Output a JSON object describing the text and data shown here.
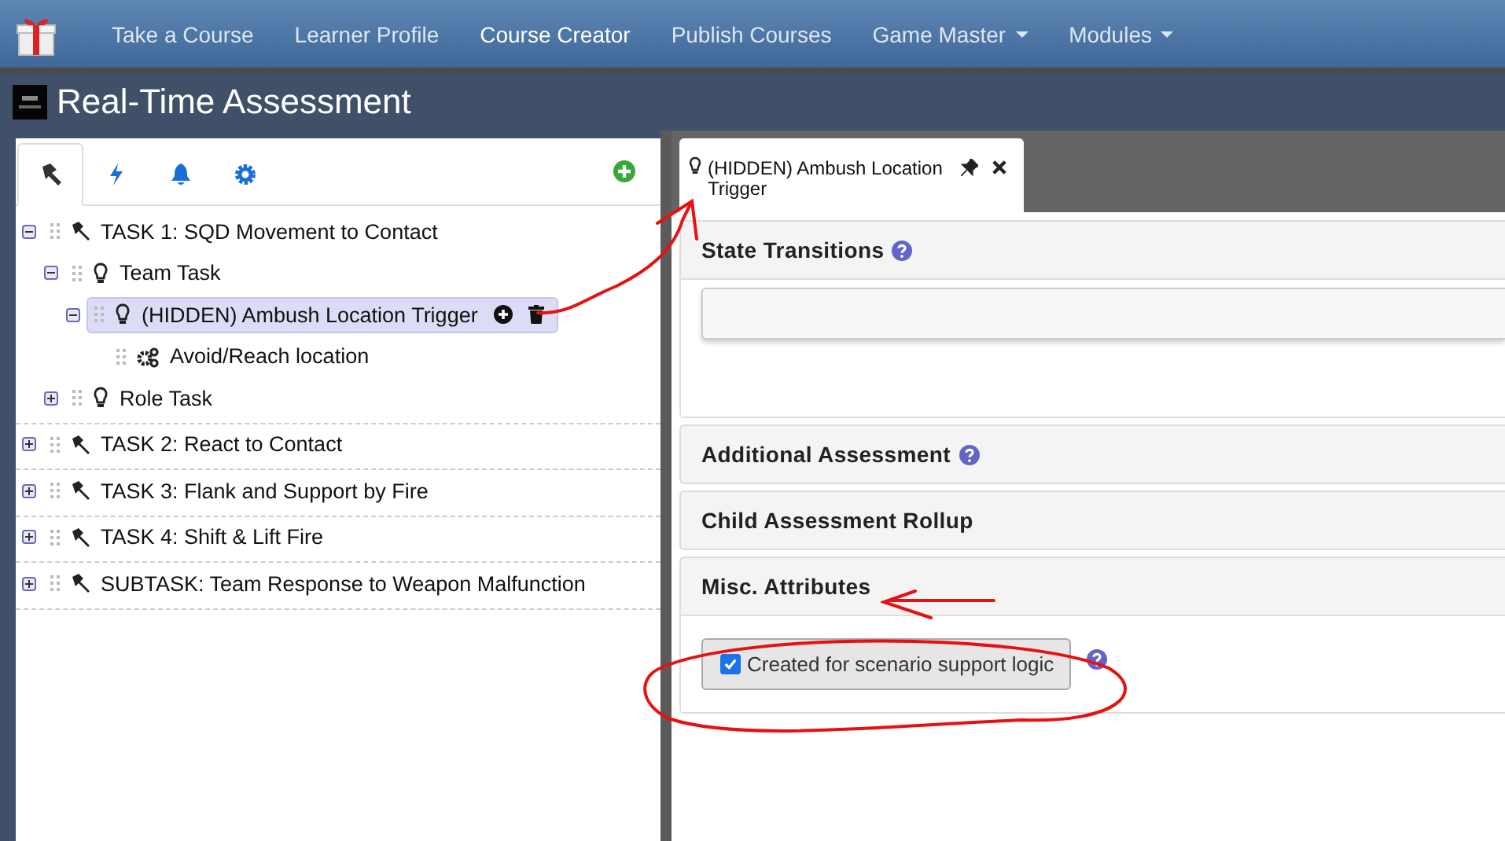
{
  "nav": {
    "items": [
      {
        "label": "Take a Course",
        "selected": false,
        "dropdown": false
      },
      {
        "label": "Learner Profile",
        "selected": false,
        "dropdown": false
      },
      {
        "label": "Course Creator",
        "selected": true,
        "dropdown": false
      },
      {
        "label": "Publish Courses",
        "selected": false,
        "dropdown": false
      },
      {
        "label": "Game Master",
        "selected": false,
        "dropdown": true
      },
      {
        "label": "Modules",
        "selected": false,
        "dropdown": true
      }
    ]
  },
  "page_title": "Real-Time Assessment",
  "outline": {
    "tabs": [
      {
        "kind": "hammer",
        "selected": true
      },
      {
        "kind": "bolt",
        "selected": false
      },
      {
        "kind": "bell",
        "selected": false
      },
      {
        "kind": "gear",
        "selected": false
      }
    ],
    "tree": [
      {
        "kind": "task",
        "label": "TASK 1: SQD Movement to Contact",
        "expanded": true,
        "selected": false,
        "children": [
          {
            "kind": "bulb",
            "label": "Team Task",
            "expanded": true,
            "selected": false,
            "children": [
              {
                "kind": "bulb",
                "label": "(HIDDEN) Ambush Location Trigger",
                "expanded": true,
                "selected": true,
                "children": [
                  {
                    "kind": "gears",
                    "label": "Avoid/Reach location",
                    "selected": false
                  }
                ]
              }
            ]
          },
          {
            "kind": "bulb",
            "label": "Role Task",
            "expanded": false,
            "selected": false
          }
        ]
      },
      {
        "kind": "task",
        "label": "TASK 2: React to Contact",
        "expanded": false,
        "selected": false
      },
      {
        "kind": "task",
        "label": "TASK 3: Flank and Support by Fire",
        "expanded": false,
        "selected": false
      },
      {
        "kind": "task",
        "label": "TASK 4: Shift & Lift Fire",
        "expanded": false,
        "selected": false
      },
      {
        "kind": "task",
        "label": "SUBTASK: Team Response to Weapon Malfunction",
        "expanded": false,
        "selected": false
      }
    ]
  },
  "editor": {
    "tab": {
      "label": "(HIDDEN) Ambush Location Trigger"
    },
    "sections": [
      {
        "title": "State Transitions",
        "help": true,
        "content": {
          "kind": "field"
        }
      },
      {
        "title": "Additional Assessment",
        "help": true
      },
      {
        "title": "Child Assessment Rollup",
        "help": false
      },
      {
        "title": "Misc. Attributes",
        "help": false,
        "content": {
          "kind": "checkbox",
          "label": "Created for scenario support logic",
          "checked": true,
          "help": true
        }
      }
    ]
  }
}
